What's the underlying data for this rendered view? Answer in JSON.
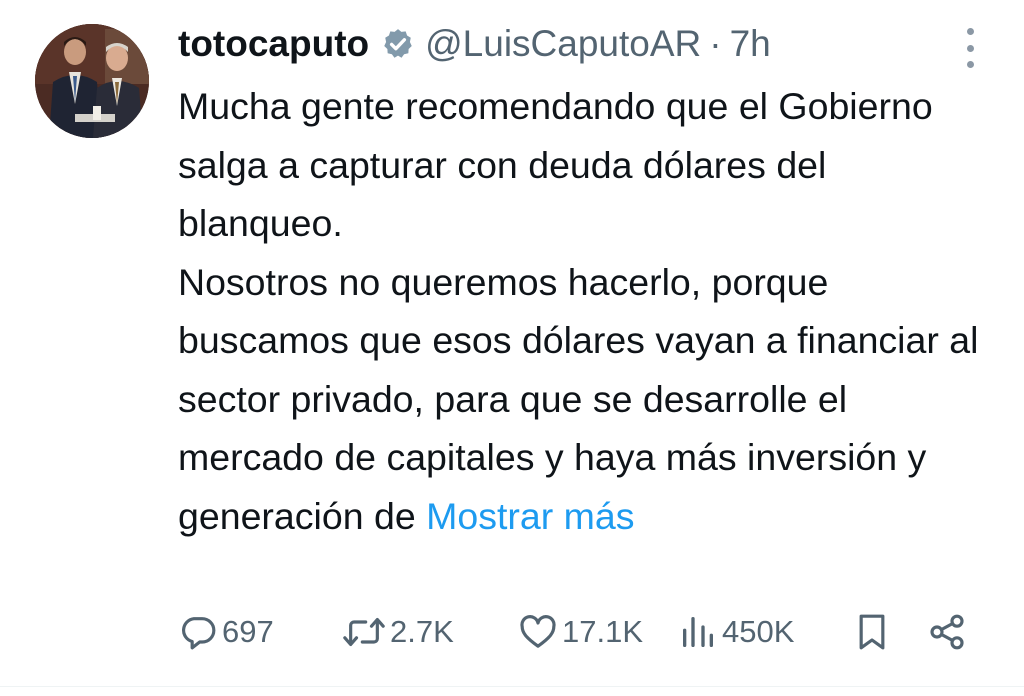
{
  "author": {
    "display_name": "totocaputo",
    "handle": "@LuisCaputoAR",
    "separator": "·",
    "time": "7h"
  },
  "icons": {
    "verified": "verified-badge-icon",
    "more": "more-vertical-icon",
    "reply": "reply-icon",
    "retweet": "retweet-icon",
    "like": "heart-icon",
    "views": "views-icon",
    "bookmark": "bookmark-icon",
    "share": "share-icon"
  },
  "tweet": {
    "paragraph_1": "Mucha gente recomendando que el Gobierno salga a capturar con deuda dólares del blanqueo.",
    "paragraph_2": "Nosotros no queremos hacerlo, porque buscamos que esos dólares vayan a financiar al sector privado, para que se desarrolle el mercado de capitales y haya más inversión y generación de",
    "show_more": "Mostrar más"
  },
  "metrics": {
    "replies": "697",
    "retweets": "2.7K",
    "likes": "17.1K",
    "views": "450K"
  },
  "colors": {
    "text": "#0f1419",
    "secondary": "#536471",
    "link": "#1d9bf0"
  }
}
